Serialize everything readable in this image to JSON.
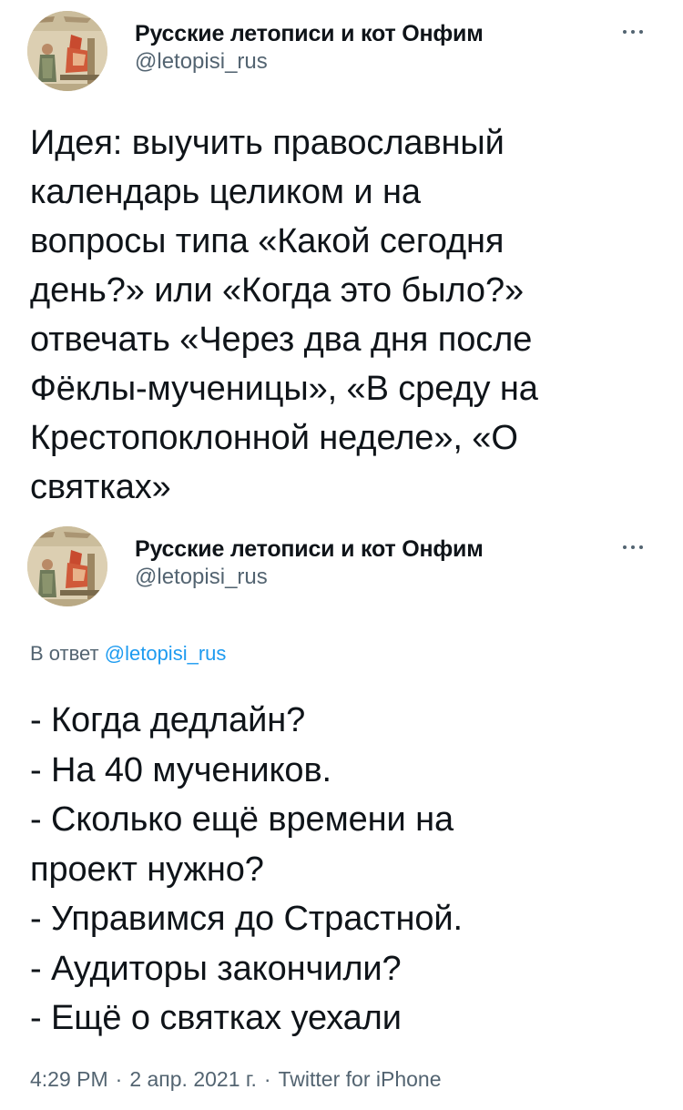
{
  "tweet1": {
    "display_name": "Русские летописи и кот Онфим",
    "handle": "@letopisi_rus",
    "text": "Идея: выучить православный\nкалендарь целиком и на\nвопросы типа «Какой сегодня\nдень?» или «Когда это было?»\nотвечать «Через два дня после\nФёклы-мученицы», «В среду на\nКрестопоклонной неделе», «О\nсвятках»",
    "avatar_icon": "manuscript-miniature-avatar-icon",
    "more_icon": "more-horizontal-icon"
  },
  "tweet2": {
    "display_name": "Русские летописи и кот Онфим",
    "handle": "@letopisi_rus",
    "reply_prefix": "В ответ",
    "reply_mention": "@letopisi_rus",
    "text": "- Когда дедлайн?\n- На 40 мучеников.\n- Сколько ещё времени на\nпроект нужно?\n- Управимся до Страстной.\n- Аудиторы закончили?\n- Ещё о святках уехали",
    "avatar_icon": "manuscript-miniature-avatar-icon",
    "more_icon": "more-horizontal-icon",
    "time": "4:29 PM",
    "date": "2 апр. 2021 г.",
    "source": "Twitter for iPhone",
    "separator": "·"
  },
  "colors": {
    "text_primary": "#0f1419",
    "text_secondary": "#536471",
    "link": "#1d9bf0",
    "background": "#ffffff"
  }
}
